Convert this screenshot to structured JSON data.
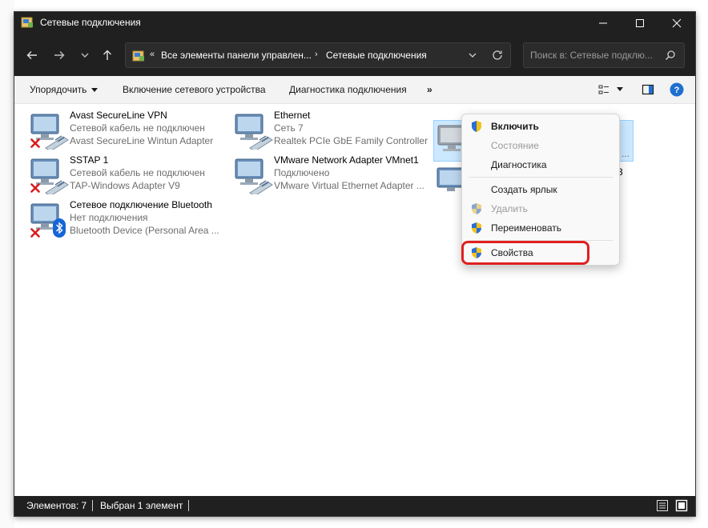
{
  "window": {
    "title": "Сетевые подключения",
    "icons": {
      "app": "network-folder-icon",
      "minimize": "minimize-icon",
      "maximize": "maximize-icon",
      "close": "close-icon"
    }
  },
  "address_bar": {
    "overflow": "«",
    "crumbs": [
      "Все элементы панели управлен...",
      "Сетевые подключения"
    ],
    "separator": "›",
    "search_placeholder": "Поиск в: Сетевые подклю..."
  },
  "command_bar": {
    "organize": "Упорядочить",
    "enable_device": "Включение сетевого устройства",
    "diagnose": "Диагностика подключения",
    "more": "»"
  },
  "connections": [
    {
      "name": "Avast SecureLine VPN",
      "status": "Сетевой кабель не подключен",
      "device": "Avast SecureLine Wintun Adapter",
      "badge": "red-x-icon"
    },
    {
      "name": "Ethernet",
      "status": "Сеть 7",
      "device": "Realtek PCIe GbE Family Controller",
      "badge": "none"
    },
    {
      "name": "",
      "status": "",
      "device": "",
      "badge": "none",
      "selected": true
    },
    {
      "name": "SSTAP 1",
      "status": "Сетевой кабель не подключен",
      "device": "TAP-Windows Adapter V9",
      "badge": "red-x-icon"
    },
    {
      "name": "VMware Network Adapter VMnet1",
      "status": "Подключено",
      "device": "VMware Virtual Ethernet Adapter ...",
      "badge": "none"
    },
    {
      "name": "",
      "status": "",
      "device": "",
      "badge": "none",
      "partial_suffix": "3"
    },
    {
      "name": "Сетевое подключение Bluetooth",
      "status": "Нет подключения",
      "device": "Bluetooth Device (Personal Area ...",
      "badge": "red-x-icon"
    }
  ],
  "selected_device_suffix": "...",
  "context_menu": [
    {
      "label": "Включить",
      "shield": true,
      "bold": true,
      "disabled": false
    },
    {
      "label": "Состояние",
      "shield": false,
      "bold": false,
      "disabled": true
    },
    {
      "label": "Диагностика",
      "shield": false,
      "bold": false,
      "disabled": false
    },
    {
      "label": "Создать ярлык",
      "shield": false,
      "bold": false,
      "disabled": false
    },
    {
      "label": "Удалить",
      "shield": true,
      "bold": false,
      "disabled": true
    },
    {
      "label": "Переименовать",
      "shield": true,
      "bold": false,
      "disabled": false
    },
    {
      "label": "Свойства",
      "shield": true,
      "bold": false,
      "disabled": false,
      "highlighted": true
    }
  ],
  "status_bar": {
    "count": "Элементов: 7",
    "selected": "Выбран 1 элемент"
  },
  "colors": {
    "titlebar": "#202020",
    "selection": "#cce8ff",
    "highlight_ring": "#e02020",
    "help": "#1f6fd1"
  }
}
